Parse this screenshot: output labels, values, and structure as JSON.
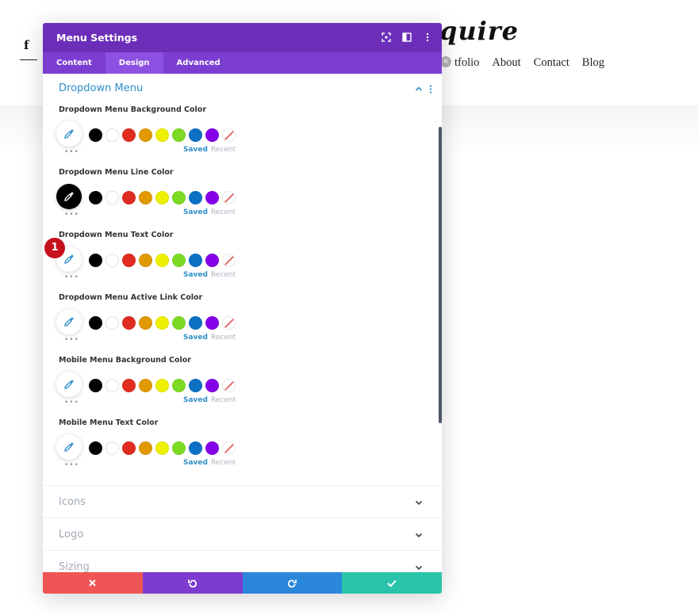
{
  "site": {
    "facebook_icon": "f",
    "logo_text": "quire",
    "nav": [
      "tfolio",
      "About",
      "Contact",
      "Blog"
    ]
  },
  "modal": {
    "title": "Menu Settings",
    "tabs": [
      {
        "label": "Content",
        "active": false
      },
      {
        "label": "Design",
        "active": true
      },
      {
        "label": "Advanced",
        "active": false
      }
    ],
    "section": {
      "title": "Dropdown Menu",
      "fields": [
        {
          "label": "Dropdown Menu Background Color"
        },
        {
          "label": "Dropdown Menu Line Color",
          "selected": "#000000"
        },
        {
          "label": "Dropdown Menu Text Color"
        },
        {
          "label": "Dropdown Menu Active Link Color"
        },
        {
          "label": "Mobile Menu Background Color"
        },
        {
          "label": "Mobile Menu Text Color"
        }
      ]
    },
    "palette": [
      "#000000",
      "#ffffff",
      "#e02b20",
      "#e09900",
      "#edf000",
      "#7cda24",
      "#0c71c3",
      "#8300e9"
    ],
    "saved_label": "Saved",
    "recent_label": "Recent",
    "more_label": "•••",
    "collapsed_sections": [
      "Icons",
      "Logo",
      "Sizing"
    ],
    "badge": "1"
  },
  "colors": {
    "header": "#6c2eb9",
    "tabs": "#7b3ed1",
    "accent": "#2e8fc7",
    "cancel": "#ef5555",
    "undo": "#7e3bd0",
    "redo": "#2b87da",
    "save": "#29c4a9"
  }
}
